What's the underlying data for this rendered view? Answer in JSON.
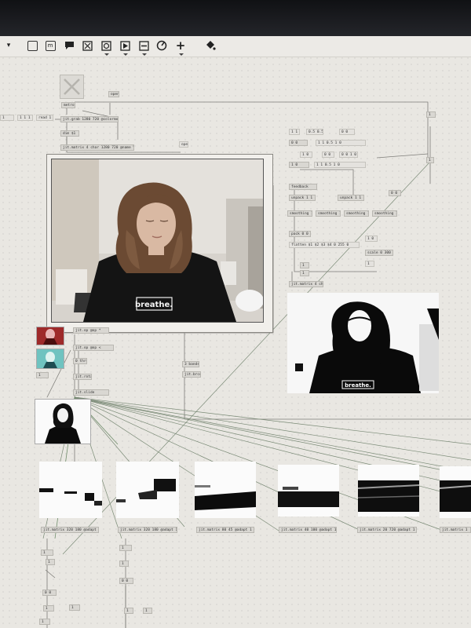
{
  "toolbar": {
    "buttons": [
      {
        "name": "new-object-icon"
      },
      {
        "name": "message-icon",
        "glyph": "m"
      },
      {
        "name": "comment-icon"
      },
      {
        "name": "toggle-icon"
      },
      {
        "name": "button-icon"
      },
      {
        "name": "playbar-icon",
        "glyph": "▷"
      },
      {
        "name": "slider-icon"
      },
      {
        "name": "dial-icon"
      },
      {
        "name": "add-icon",
        "glyph": "+"
      },
      {
        "name": "paint-bucket-icon"
      }
    ]
  },
  "patch": {
    "objects": {
      "o_metro": "metro 33",
      "o_open": "open",
      "o_jit": "jit.grab 1280 720 @colormode argb",
      "o_dim": "dim $1",
      "o_matrix": "jit.matrix 4 char 1280 720 @name VideoMatrix",
      "o_1": "1",
      "o_10": "1 1 1",
      "o_11": "read 1 1",
      "o_op": "open",
      "o_scale1": "1 1",
      "o_scale2": "0.5 0.5",
      "o_scale3": "0 0",
      "o_vals": "1 1 0.5 1 0",
      "o_p1": "0 0",
      "o_p2": "1 0",
      "o_p3": "0 0 1 0",
      "o_feedback": "feedback",
      "o_unpack": "unpack 1 1",
      "o_smooth1": "smoothing 10",
      "o_smooth2": "smoothing 10",
      "o_smooth3": "smoothing 10",
      "o_smooth4": "smoothing 10",
      "o_pack": "pack 0 0 0 0",
      "o_fmt": "flatten $1 $2 $3 $4 0 255 0",
      "o_sc": "scale 0 300 0 127",
      "o_matrix2": "jit.matrix 4 char 1280 720",
      "o_mode1": "jit.op @op *",
      "o_mode2": "jit.op @op <",
      "o_mode3": "0 thresh",
      "o_mode4": "jit.rota",
      "o_mode5": "jit.slide",
      "o_r1": "3 bands",
      "o_r2": "jit.brcosa",
      "o_bl1": "jit.matrix 320 180 @adapt 1",
      "o_bl2": "jit.matrix 320 180 @adapt 1",
      "o_bl3": "jit.matrix 80 45 @adapt 1",
      "o_bl4": "jit.matrix 40 100 @adapt 1",
      "o_bl5": "jit.matrix 20 720 @adapt 1",
      "o_bl6": "jit.matrix 1"
    },
    "video_shirt_text": "breathe."
  }
}
